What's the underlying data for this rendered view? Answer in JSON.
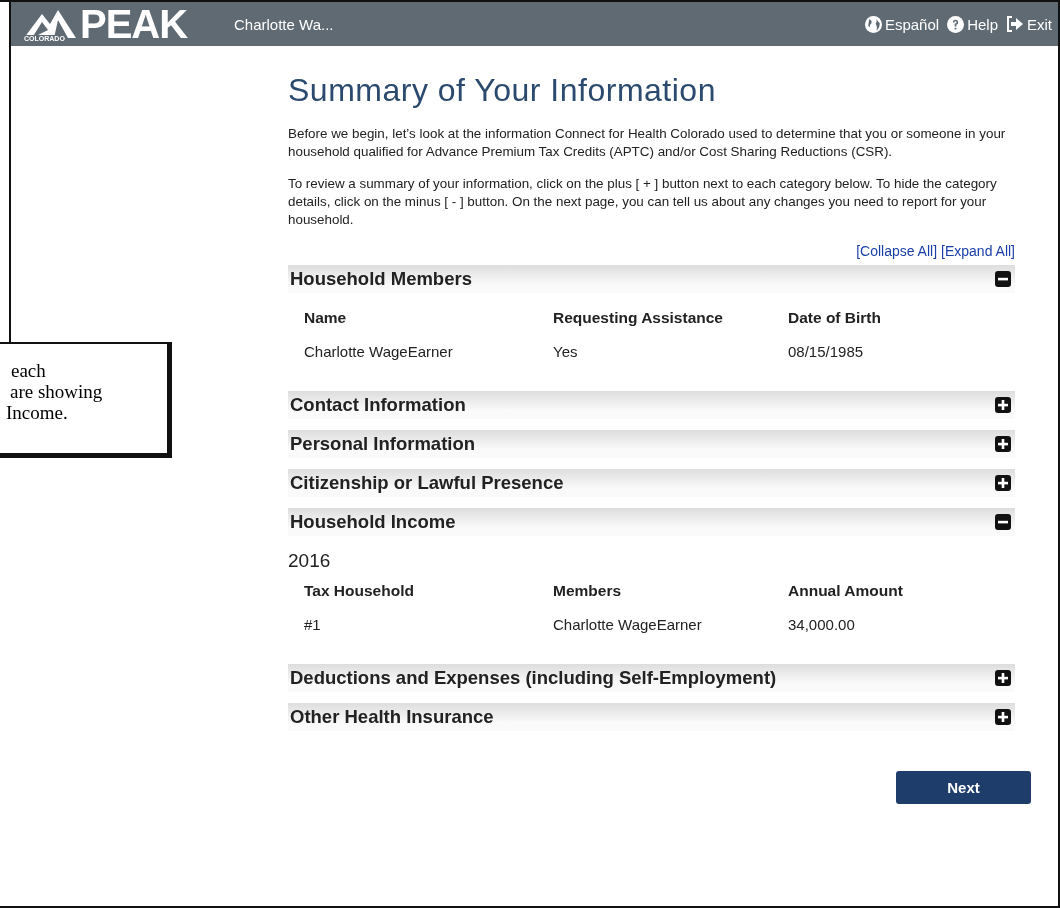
{
  "header": {
    "logo_small": "COLORADO",
    "logo": "PEAK",
    "user": "Charlotte Wa...",
    "links": [
      {
        "kind": "globe",
        "label": "Español"
      },
      {
        "kind": "help",
        "label": "Help"
      },
      {
        "kind": "exit",
        "label": "Exit"
      }
    ]
  },
  "title": "Summary of Your Information",
  "paragraphs": [
    "Before we begin, let’s look at the information Connect for Health Colorado used to determine that you or someone in your household qualified for Advance Premium Tax Credits (APTC) and/or Cost Sharing Reductions (CSR).",
    "To review a summary of your information, click on the plus [ + ] button next to each category below. To hide the category details, click on the minus [ - ] button. On the next page, you can tell us about any changes you need to report for your household."
  ],
  "toggle_links": [
    "[Collapse All]",
    "[Expand All]"
  ],
  "sections": [
    {
      "title": "Household Members",
      "expanded": true,
      "columns": [
        "Name",
        "Requesting Assistance",
        "Date of Birth"
      ],
      "rows": [
        [
          "Charlotte WageEarner",
          "Yes",
          "08/15/1985"
        ]
      ]
    },
    {
      "title": "Contact Information",
      "expanded": false
    },
    {
      "title": "Personal Information",
      "expanded": false
    },
    {
      "title": "Citizenship or Lawful Presence",
      "expanded": false
    },
    {
      "title": "Household Income",
      "expanded": true,
      "year": "2016",
      "columns": [
        "Tax Household",
        "Members",
        "Annual Amount"
      ],
      "rows": [
        [
          "#1",
          "Charlotte WageEarner",
          "34,000.00"
        ]
      ]
    },
    {
      "title": "Deductions and Expenses (including Self-Employment)",
      "expanded": false
    },
    {
      "title": "Other Health Insurance",
      "expanded": false
    }
  ],
  "next_button": "Next",
  "callout": [
    "each",
    "are showing",
    "Income."
  ]
}
